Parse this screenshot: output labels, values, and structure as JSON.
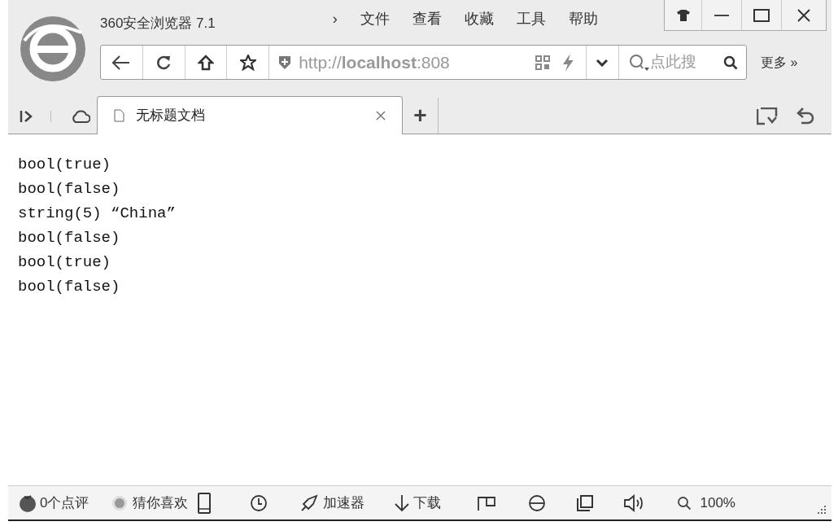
{
  "window": {
    "title": "360安全浏览器 7.1"
  },
  "menu": [
    {
      "label": "›"
    },
    {
      "label": "文件"
    },
    {
      "label": "查看"
    },
    {
      "label": "收藏"
    },
    {
      "label": "工具"
    },
    {
      "label": "帮助"
    }
  ],
  "address_bar": {
    "url": "http://**localhost**:808",
    "search_placeholder": "点此搜"
  },
  "more_button": "更多 »",
  "tabs": [
    {
      "title": "无标题文档",
      "selected": true
    }
  ],
  "new_tab": "+",
  "content": [
    "bool(true)",
    "bool(false)",
    "string(5) “China”",
    "bool(false)",
    "bool(true)",
    "bool(false)"
  ],
  "status_bar": [
    {
      "kind": "tomato",
      "text": "0个点评"
    },
    {
      "kind": "dot",
      "text": "猜你喜欢"
    },
    {
      "kind": "phone"
    },
    {
      "kind": "clock"
    },
    {
      "kind": "rocket",
      "text": "加速器"
    },
    {
      "kind": "download",
      "text": "下载"
    },
    {
      "kind": "flag"
    },
    {
      "kind": "ie"
    },
    {
      "kind": "window"
    },
    {
      "kind": "speaker"
    },
    {
      "kind": "zoom",
      "text": "100%"
    }
  ]
}
